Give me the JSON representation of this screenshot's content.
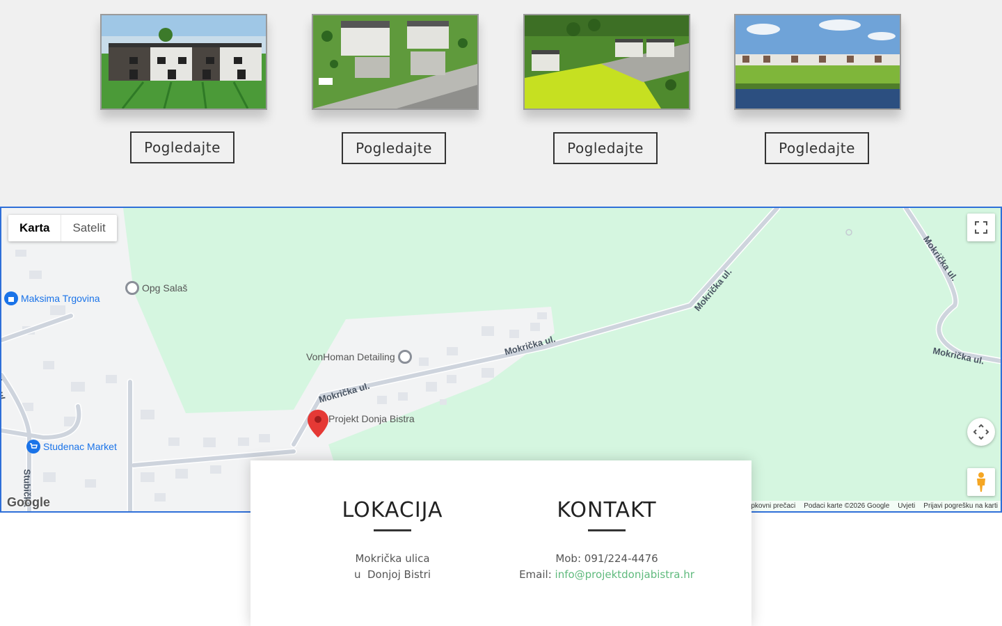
{
  "gallery": {
    "button_label": "Pogledajte",
    "items": [
      {
        "image": "rendered-townhouses-front"
      },
      {
        "image": "rendered-houses-aerial"
      },
      {
        "image": "rendered-site-aerial"
      },
      {
        "image": "rendered-townhouses-river"
      }
    ]
  },
  "map": {
    "type_map": "Karta",
    "type_satellite": "Satelit",
    "pois": {
      "maksima": "Maksima Trgovina",
      "opg": "Opg Salaš",
      "vonhoman": "VonHoman Detailing",
      "projekt": "Projekt Donja Bistra",
      "studenac": "Studenac Market"
    },
    "streets": {
      "s1": "Mokrička ul.",
      "s2": "Mokrička ul.",
      "s3": "Mokrička ul.",
      "s4": "Mokrička ul.",
      "s5": "Mokrička ul.",
      "s6": "Stubička",
      "s7": "ka ul."
    },
    "logo": "Google",
    "attribution": {
      "shortcuts": "pkovni prečaci",
      "data": "Podaci karte ©2026 Google",
      "terms": "Uvjeti",
      "report": "Prijavi pogrešku na karti"
    },
    "icons": [
      "fullscreen-icon",
      "camera-control-icon",
      "pegman-icon",
      "map-pin-icon"
    ],
    "colors": {
      "park": "#d5f6e0",
      "urban": "#f2f3f4",
      "road": "#ced4dd",
      "pin": "#e53935",
      "poi_blue": "#1a73e8"
    }
  },
  "location": {
    "title": "LOKACIJA",
    "line1": "Mokrička ulica",
    "line2": "u  Donjoj Bistri"
  },
  "contact": {
    "title": "KONTAKT",
    "mobile": "Mob: 091/224-4476",
    "email_label": "Email:",
    "email": "info@projektdonjabistra.hr"
  }
}
